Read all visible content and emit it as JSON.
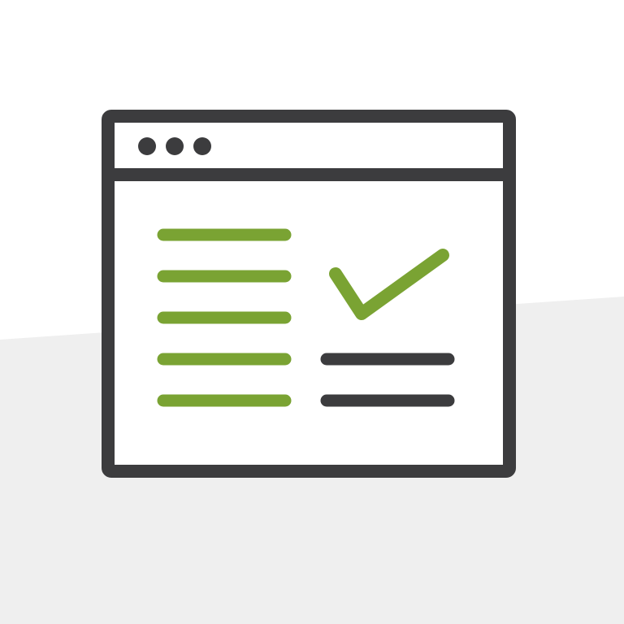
{
  "colors": {
    "background": "#ffffff",
    "background_band": "#efefef",
    "frame": "#3c3c3e",
    "accent": "#7aa333",
    "window_fill": "#ffffff"
  },
  "icons": {
    "illustration": "browser-window-checklist-icon",
    "title_dots": "window-control-dots-icon",
    "checkmark": "checkmark-icon"
  },
  "window": {
    "control_dot_count": 3,
    "left_list_line_count": 5,
    "right_text_line_count": 2
  }
}
